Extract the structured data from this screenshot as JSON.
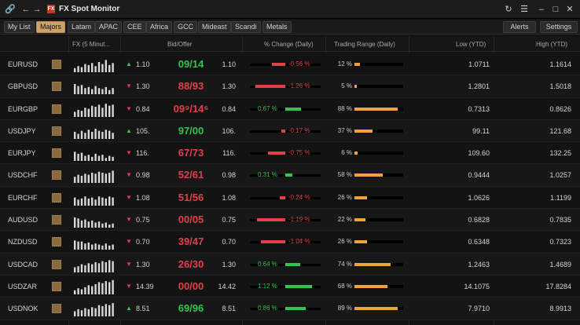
{
  "window": {
    "title": "FX Spot Monitor",
    "logo_letters": "FX",
    "left_icons": [
      "link-icon",
      "back-arrow-icon",
      "forward-arrow-icon"
    ],
    "right_icons": [
      "refresh-icon",
      "menu-icon",
      "minimize-icon",
      "maximize-icon",
      "close-icon"
    ]
  },
  "tabs": [
    "My List",
    "Majors",
    "Latam",
    "APAC",
    "CEE",
    "Africa",
    "GCC",
    "Mideast",
    "Scandi",
    "Metals"
  ],
  "active_tab": "Majors",
  "toolbar": {
    "alerts_label": "Alerts",
    "settings_label": "Settings"
  },
  "columns": {
    "fx": "FX (5 Minut...",
    "bid_offer": "Bid/Offer",
    "pct_change": "% Change (Daily)",
    "trading_range": "Trading Range (Daily)",
    "low": "Low (YTD)",
    "high": "High (YTD)"
  },
  "colors": {
    "up": "#36c24f",
    "down": "#e0404a",
    "accent_tab": "#c9a36a",
    "range_bar": "#f0a13c"
  },
  "rows": [
    {
      "pair": "EURUSD",
      "dir": "up",
      "bid": "1.10",
      "big": "09/14",
      "offer": "1.10",
      "chg": "-0.56 %",
      "chg_value": -0.56,
      "range": "12 %",
      "range_value": 12,
      "low": "1.0711",
      "high": "1.1614"
    },
    {
      "pair": "GBPUSD",
      "dir": "down",
      "bid": "1.30",
      "big": "88/93",
      "offer": "1.30",
      "chg": "-1.26 %",
      "chg_value": -1.26,
      "range": "5 %",
      "range_value": 5,
      "low": "1.2801",
      "high": "1.5018"
    },
    {
      "pair": "EURGBP",
      "dir": "down",
      "bid": "0.84",
      "big": "09⁹/14⁶",
      "offer": "0.84",
      "chg": "0.67 %",
      "chg_value": 0.67,
      "range": "88 %",
      "range_value": 88,
      "low": "0.7313",
      "high": "0.8626"
    },
    {
      "pair": "USDJPY",
      "dir": "up",
      "bid": "105.",
      "big": "97/00",
      "offer": "106.",
      "chg": "-0.17 %",
      "chg_value": -0.17,
      "range": "37 %",
      "range_value": 37,
      "low": "99.11",
      "high": "121.68"
    },
    {
      "pair": "EURJPY",
      "dir": "down",
      "bid": "116.",
      "big": "67/73",
      "offer": "116.",
      "chg": "-0.75 %",
      "chg_value": -0.75,
      "range": "6 %",
      "range_value": 6,
      "low": "109.60",
      "high": "132.25"
    },
    {
      "pair": "USDCHF",
      "dir": "down",
      "bid": "0.98",
      "big": "52/61",
      "offer": "0.98",
      "chg": "0.31 %",
      "chg_value": 0.31,
      "range": "58 %",
      "range_value": 58,
      "low": "0.9444",
      "high": "1.0257"
    },
    {
      "pair": "EURCHF",
      "dir": "down",
      "bid": "1.08",
      "big": "51/56",
      "offer": "1.08",
      "chg": "-0.24 %",
      "chg_value": -0.24,
      "range": "26 %",
      "range_value": 26,
      "low": "1.0626",
      "high": "1.1199"
    },
    {
      "pair": "AUDUSD",
      "dir": "down",
      "bid": "0.75",
      "big": "00/05",
      "offer": "0.75",
      "chg": "-1.19 %",
      "chg_value": -1.19,
      "range": "22 %",
      "range_value": 22,
      "low": "0.6828",
      "high": "0.7835"
    },
    {
      "pair": "NZDUSD",
      "dir": "down",
      "bid": "0.70",
      "big": "39/47",
      "offer": "0.70",
      "chg": "-1.04 %",
      "chg_value": -1.04,
      "range": "26 %",
      "range_value": 26,
      "low": "0.6348",
      "high": "0.7323"
    },
    {
      "pair": "USDCAD",
      "dir": "down",
      "bid": "1.30",
      "big": "26/30",
      "offer": "1.30",
      "chg": "0.64 %",
      "chg_value": 0.64,
      "range": "74 %",
      "range_value": 74,
      "low": "1.2463",
      "high": "1.4689"
    },
    {
      "pair": "USDZAR",
      "dir": "down",
      "bid": "14.39",
      "big": "00/00",
      "offer": "14.42",
      "chg": "1.12 %",
      "chg_value": 1.12,
      "range": "68 %",
      "range_value": 68,
      "low": "14.1075",
      "high": "17.8284"
    },
    {
      "pair": "USDNOK",
      "dir": "up",
      "bid": "8.51",
      "big": "69/96",
      "offer": "8.51",
      "chg": "0.86 %",
      "chg_value": 0.86,
      "range": "89 %",
      "range_value": 89,
      "low": "7.9710",
      "high": "8.9913"
    }
  ]
}
